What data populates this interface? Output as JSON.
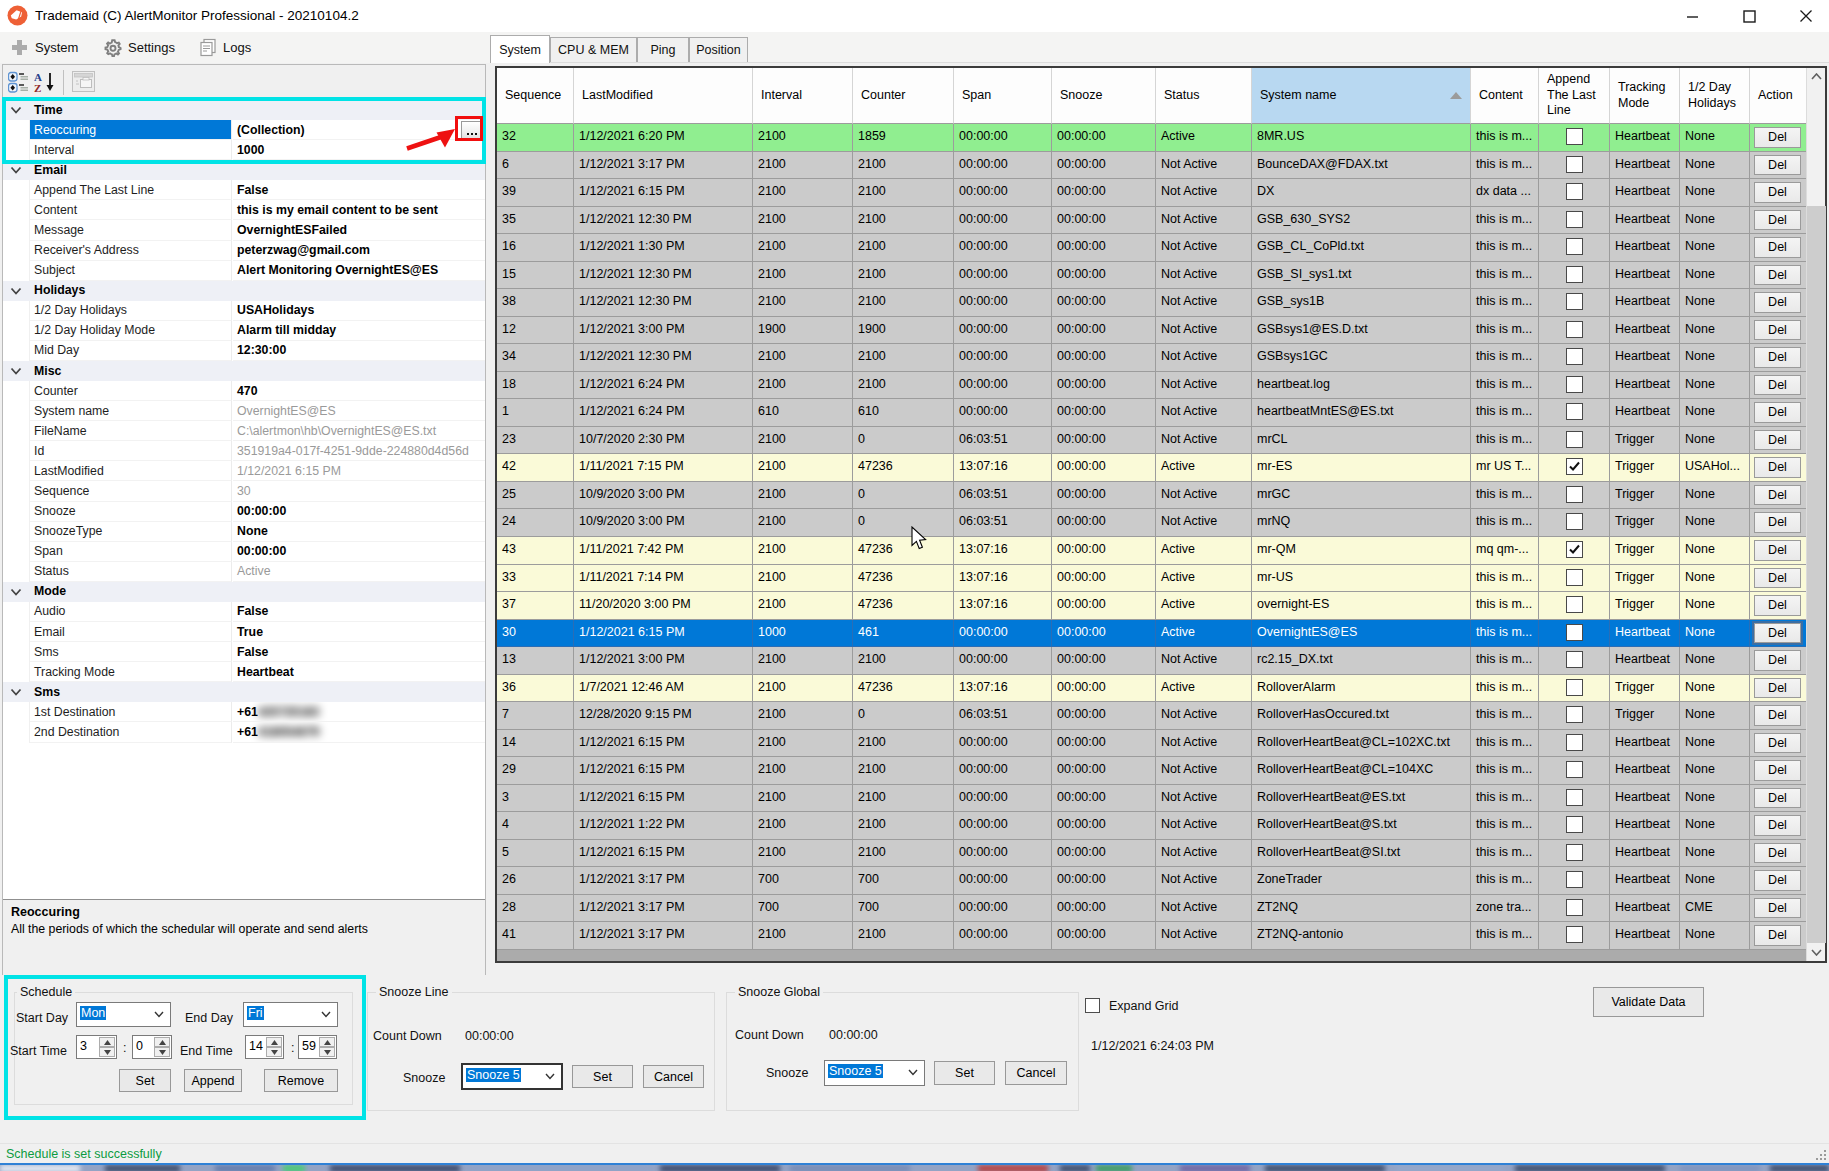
{
  "window": {
    "title": "Trademaid (C) AlertMonitor Professional - 20210104.2",
    "controls": [
      "minimize",
      "maximize",
      "close"
    ]
  },
  "menubar": {
    "items": [
      {
        "label": "System",
        "icon": "plus-icon"
      },
      {
        "label": "Settings",
        "icon": "gear-icon"
      },
      {
        "label": "Logs",
        "icon": "logs-icon"
      }
    ]
  },
  "property_grid": {
    "toolbar_icons": [
      "categorized-icon",
      "alphabetical-sort-icon",
      "property-pages-icon"
    ],
    "sections": [
      {
        "label": "Time",
        "items": [
          {
            "name": "Reoccuring",
            "value": "(Collection)",
            "selected": true,
            "button": "..."
          },
          {
            "name": "Interval",
            "value": "1000"
          }
        ]
      },
      {
        "label": "Email",
        "items": [
          {
            "name": "Append The Last Line",
            "value": "False"
          },
          {
            "name": "Content",
            "value": "this is my email content to be sent"
          },
          {
            "name": "Message",
            "value": "OvernightESFailed"
          },
          {
            "name": "Receiver's Address",
            "value": "peterzwag@gmail.com"
          },
          {
            "name": "Subject",
            "value": "Alert Monitoring OvernightES@ES"
          }
        ]
      },
      {
        "label": "Holidays",
        "items": [
          {
            "name": "1/2 Day Holidays",
            "value": "USAHolidays"
          },
          {
            "name": "1/2 Day Holiday Mode",
            "value": "Alarm till midday"
          },
          {
            "name": "Mid Day",
            "value": "12:30:00"
          }
        ]
      },
      {
        "label": "Misc",
        "items": [
          {
            "name": "Counter",
            "value": "470"
          },
          {
            "name": "System name",
            "value": "OvernightES@ES",
            "readonly": true
          },
          {
            "name": "FileName",
            "value": "C:\\alertmon\\hb\\OvernightES@ES.txt",
            "readonly": true
          },
          {
            "name": "Id",
            "value": "351919a4-017f-4251-9dde-224880d4d56d",
            "readonly": true
          },
          {
            "name": "LastModified",
            "value": "1/12/2021 6:15 PM",
            "readonly": true
          },
          {
            "name": "Sequence",
            "value": "30",
            "readonly": true
          },
          {
            "name": "Snooze",
            "value": "00:00:00"
          },
          {
            "name": "SnoozeType",
            "value": "None"
          },
          {
            "name": "Span",
            "value": "00:00:00"
          },
          {
            "name": "Status",
            "value": "Active",
            "readonly": true
          }
        ]
      },
      {
        "label": "Mode",
        "items": [
          {
            "name": "Audio",
            "value": "False"
          },
          {
            "name": "Email",
            "value": "True"
          },
          {
            "name": "Sms",
            "value": "False"
          },
          {
            "name": "Tracking Mode",
            "value": "Heartbeat"
          }
        ]
      },
      {
        "label": "Sms",
        "items": [
          {
            "name": "1st Destination",
            "value": "+61",
            "blurred_suffix": "425725183"
          },
          {
            "name": "2nd Destination",
            "value": "+61",
            "blurred_suffix": "418054679"
          }
        ]
      }
    ],
    "description": {
      "title": "Reoccuring",
      "text": "All the periods of which the schedular will operate and send alerts"
    }
  },
  "tabs": [
    "System",
    "CPU & MEM",
    "Ping",
    "Position"
  ],
  "selected_tab": "System",
  "grid": {
    "columns": [
      "Sequence",
      "LastModified",
      "Interval",
      "Counter",
      "Span",
      "Snooze",
      "Status",
      "System name",
      "Content",
      "Append The Last Line",
      "Tracking Mode",
      "1/2 Day Holidays",
      "Action"
    ],
    "sorted_column": "System name",
    "action_label": "Del",
    "rows": [
      {
        "seq": "32",
        "modified": "1/12/2021 6:20 PM",
        "interval": "2100",
        "counter": "1859",
        "span": "00:00:00",
        "snooze": "00:00:00",
        "status": "Active",
        "system": "8MR.US",
        "content": "this is m...",
        "checked": false,
        "tracking": "Heartbeat",
        "holidays": "None",
        "style": "green"
      },
      {
        "seq": "6",
        "modified": "1/12/2021 3:17 PM",
        "interval": "2100",
        "counter": "2100",
        "span": "00:00:00",
        "snooze": "00:00:00",
        "status": "Not Active",
        "system": "BounceDAX@FDAX.txt",
        "content": "this is m...",
        "checked": false,
        "tracking": "Heartbeat",
        "holidays": "None",
        "style": "gray"
      },
      {
        "seq": "39",
        "modified": "1/12/2021 6:15 PM",
        "interval": "2100",
        "counter": "2100",
        "span": "00:00:00",
        "snooze": "00:00:00",
        "status": "Not Active",
        "system": "DX",
        "content": "dx data ...",
        "checked": false,
        "tracking": "Heartbeat",
        "holidays": "None",
        "style": "gray"
      },
      {
        "seq": "35",
        "modified": "1/12/2021 12:30 PM",
        "interval": "2100",
        "counter": "2100",
        "span": "00:00:00",
        "snooze": "00:00:00",
        "status": "Not Active",
        "system": "GSB_630_SYS2",
        "content": "this is m...",
        "checked": false,
        "tracking": "Heartbeat",
        "holidays": "None",
        "style": "gray"
      },
      {
        "seq": "16",
        "modified": "1/12/2021 1:30 PM",
        "interval": "2100",
        "counter": "2100",
        "span": "00:00:00",
        "snooze": "00:00:00",
        "status": "Not Active",
        "system": "GSB_CL_CoPld.txt",
        "content": "this is m...",
        "checked": false,
        "tracking": "Heartbeat",
        "holidays": "None",
        "style": "gray"
      },
      {
        "seq": "15",
        "modified": "1/12/2021 12:30 PM",
        "interval": "2100",
        "counter": "2100",
        "span": "00:00:00",
        "snooze": "00:00:00",
        "status": "Not Active",
        "system": "GSB_SI_sys1.txt",
        "content": "this is m...",
        "checked": false,
        "tracking": "Heartbeat",
        "holidays": "None",
        "style": "gray"
      },
      {
        "seq": "38",
        "modified": "1/12/2021 12:30 PM",
        "interval": "2100",
        "counter": "2100",
        "span": "00:00:00",
        "snooze": "00:00:00",
        "status": "Not Active",
        "system": "GSB_sys1B",
        "content": "this is m...",
        "checked": false,
        "tracking": "Heartbeat",
        "holidays": "None",
        "style": "gray"
      },
      {
        "seq": "12",
        "modified": "1/12/2021 3:00 PM",
        "interval": "1900",
        "counter": "1900",
        "span": "00:00:00",
        "snooze": "00:00:00",
        "status": "Not Active",
        "system": "GSBsys1@ES.D.txt",
        "content": "this is m...",
        "checked": false,
        "tracking": "Heartbeat",
        "holidays": "None",
        "style": "gray"
      },
      {
        "seq": "34",
        "modified": "1/12/2021 12:30 PM",
        "interval": "2100",
        "counter": "2100",
        "span": "00:00:00",
        "snooze": "00:00:00",
        "status": "Not Active",
        "system": "GSBsys1GC",
        "content": "this is m...",
        "checked": false,
        "tracking": "Heartbeat",
        "holidays": "None",
        "style": "gray"
      },
      {
        "seq": "18",
        "modified": "1/12/2021 6:24 PM",
        "interval": "2100",
        "counter": "2100",
        "span": "00:00:00",
        "snooze": "00:00:00",
        "status": "Not Active",
        "system": "heartbeat.log",
        "content": "this is m...",
        "checked": false,
        "tracking": "Heartbeat",
        "holidays": "None",
        "style": "gray"
      },
      {
        "seq": "1",
        "modified": "1/12/2021 6:24 PM",
        "interval": "610",
        "counter": "610",
        "span": "00:00:00",
        "snooze": "00:00:00",
        "status": "Not Active",
        "system": "heartbeatMntES@ES.txt",
        "content": "this is m...",
        "checked": false,
        "tracking": "Heartbeat",
        "holidays": "None",
        "style": "gray"
      },
      {
        "seq": "23",
        "modified": "10/7/2020 2:30 PM",
        "interval": "2100",
        "counter": "0",
        "span": "06:03:51",
        "snooze": "00:00:00",
        "status": "Not Active",
        "system": "mrCL",
        "content": "this is m...",
        "checked": false,
        "tracking": "Trigger",
        "holidays": "None",
        "style": "gray"
      },
      {
        "seq": "42",
        "modified": "1/11/2021 7:15 PM",
        "interval": "2100",
        "counter": "47236",
        "span": "13:07:16",
        "snooze": "00:00:00",
        "status": "Active",
        "system": "mr-ES",
        "content": "mr US T...",
        "checked": true,
        "tracking": "Trigger",
        "holidays": "USAHol...",
        "style": "yellow"
      },
      {
        "seq": "25",
        "modified": "10/9/2020 3:00 PM",
        "interval": "2100",
        "counter": "0",
        "span": "06:03:51",
        "snooze": "00:00:00",
        "status": "Not Active",
        "system": "mrGC",
        "content": "this is m...",
        "checked": false,
        "tracking": "Trigger",
        "holidays": "None",
        "style": "gray"
      },
      {
        "seq": "24",
        "modified": "10/9/2020 3:00 PM",
        "interval": "2100",
        "counter": "0",
        "span": "06:03:51",
        "snooze": "00:00:00",
        "status": "Not Active",
        "system": "mrNQ",
        "content": "this is m...",
        "checked": false,
        "tracking": "Trigger",
        "holidays": "None",
        "style": "gray"
      },
      {
        "seq": "43",
        "modified": "1/11/2021 7:42 PM",
        "interval": "2100",
        "counter": "47236",
        "span": "13:07:16",
        "snooze": "00:00:00",
        "status": "Active",
        "system": "mr-QM",
        "content": "mq qm-...",
        "checked": true,
        "tracking": "Trigger",
        "holidays": "None",
        "style": "yellow"
      },
      {
        "seq": "33",
        "modified": "1/11/2021 7:14 PM",
        "interval": "2100",
        "counter": "47236",
        "span": "13:07:16",
        "snooze": "00:00:00",
        "status": "Active",
        "system": "mr-US",
        "content": "this is m...",
        "checked": false,
        "tracking": "Trigger",
        "holidays": "None",
        "style": "yellow"
      },
      {
        "seq": "37",
        "modified": "11/20/2020 3:00 PM",
        "interval": "2100",
        "counter": "47236",
        "span": "13:07:16",
        "snooze": "00:00:00",
        "status": "Active",
        "system": "overnight-ES",
        "content": "this is m...",
        "checked": false,
        "tracking": "Trigger",
        "holidays": "None",
        "style": "yellow"
      },
      {
        "seq": "30",
        "modified": "1/12/2021 6:15 PM",
        "interval": "1000",
        "counter": "461",
        "span": "00:00:00",
        "snooze": "00:00:00",
        "status": "Active",
        "system": "OvernightES@ES",
        "content": "this is m...",
        "checked": false,
        "tracking": "Heartbeat",
        "holidays": "None",
        "style": "selected"
      },
      {
        "seq": "13",
        "modified": "1/12/2021 3:00 PM",
        "interval": "2100",
        "counter": "2100",
        "span": "00:00:00",
        "snooze": "00:00:00",
        "status": "Not Active",
        "system": "rc2.15_DX.txt",
        "content": "this is m...",
        "checked": false,
        "tracking": "Heartbeat",
        "holidays": "None",
        "style": "gray"
      },
      {
        "seq": "36",
        "modified": "1/7/2021 12:46 AM",
        "interval": "2100",
        "counter": "47236",
        "span": "13:07:16",
        "snooze": "00:00:00",
        "status": "Active",
        "system": "RolloverAlarm",
        "content": "this is m...",
        "checked": false,
        "tracking": "Trigger",
        "holidays": "None",
        "style": "yellow"
      },
      {
        "seq": "7",
        "modified": "12/28/2020 9:15 PM",
        "interval": "2100",
        "counter": "0",
        "span": "06:03:51",
        "snooze": "00:00:00",
        "status": "Not Active",
        "system": "RolloverHasOccured.txt",
        "content": "this is m...",
        "checked": false,
        "tracking": "Trigger",
        "holidays": "None",
        "style": "gray"
      },
      {
        "seq": "14",
        "modified": "1/12/2021 6:15 PM",
        "interval": "2100",
        "counter": "2100",
        "span": "00:00:00",
        "snooze": "00:00:00",
        "status": "Not Active",
        "system": "RolloverHeartBeat@CL=102XC.txt",
        "content": "this is m...",
        "checked": false,
        "tracking": "Heartbeat",
        "holidays": "None",
        "style": "gray"
      },
      {
        "seq": "29",
        "modified": "1/12/2021 6:15 PM",
        "interval": "2100",
        "counter": "2100",
        "span": "00:00:00",
        "snooze": "00:00:00",
        "status": "Not Active",
        "system": "RolloverHeartBeat@CL=104XC",
        "content": "this is m...",
        "checked": false,
        "tracking": "Heartbeat",
        "holidays": "None",
        "style": "gray"
      },
      {
        "seq": "3",
        "modified": "1/12/2021 6:15 PM",
        "interval": "2100",
        "counter": "2100",
        "span": "00:00:00",
        "snooze": "00:00:00",
        "status": "Not Active",
        "system": "RolloverHeartBeat@ES.txt",
        "content": "this is m...",
        "checked": false,
        "tracking": "Heartbeat",
        "holidays": "None",
        "style": "gray"
      },
      {
        "seq": "4",
        "modified": "1/12/2021 1:22 PM",
        "interval": "2100",
        "counter": "2100",
        "span": "00:00:00",
        "snooze": "00:00:00",
        "status": "Not Active",
        "system": "RolloverHeartBeat@S.txt",
        "content": "this is m...",
        "checked": false,
        "tracking": "Heartbeat",
        "holidays": "None",
        "style": "gray"
      },
      {
        "seq": "5",
        "modified": "1/12/2021 6:15 PM",
        "interval": "2100",
        "counter": "2100",
        "span": "00:00:00",
        "snooze": "00:00:00",
        "status": "Not Active",
        "system": "RolloverHeartBeat@SI.txt",
        "content": "this is m...",
        "checked": false,
        "tracking": "Heartbeat",
        "holidays": "None",
        "style": "gray"
      },
      {
        "seq": "26",
        "modified": "1/12/2021 3:17 PM",
        "interval": "700",
        "counter": "700",
        "span": "00:00:00",
        "snooze": "00:00:00",
        "status": "Not Active",
        "system": "ZoneTrader",
        "content": "this is m...",
        "checked": false,
        "tracking": "Heartbeat",
        "holidays": "None",
        "style": "gray"
      },
      {
        "seq": "28",
        "modified": "1/12/2021 3:17 PM",
        "interval": "700",
        "counter": "700",
        "span": "00:00:00",
        "snooze": "00:00:00",
        "status": "Not Active",
        "system": "ZT2NQ",
        "content": "zone tra...",
        "checked": false,
        "tracking": "Heartbeat",
        "holidays": "CME",
        "style": "gray"
      },
      {
        "seq": "41",
        "modified": "1/12/2021 3:17 PM",
        "interval": "2100",
        "counter": "2100",
        "span": "00:00:00",
        "snooze": "00:00:00",
        "status": "Not Active",
        "system": "ZT2NQ-antonio",
        "content": "this is m...",
        "checked": false,
        "tracking": "Heartbeat",
        "holidays": "None",
        "style": "gray"
      }
    ]
  },
  "schedule": {
    "label": "Schedule",
    "start_day_label": "Start Day",
    "start_day": "Mon",
    "end_day_label": "End Day",
    "end_day": "Fri",
    "start_time_label": "Start Time",
    "start_hour": "3",
    "start_min": "0",
    "end_time_label": "End Time",
    "end_hour": "14",
    "end_min": "59",
    "buttons": {
      "set": "Set",
      "append": "Append",
      "remove": "Remove"
    }
  },
  "snooze_line": {
    "label": "Snooze Line",
    "count_down_label": "Count Down",
    "count_down": "00:00:00",
    "snooze_label": "Snooze",
    "snooze_value": "Snooze 5",
    "set_label": "Set",
    "cancel_label": "Cancel"
  },
  "snooze_global": {
    "label": "Snooze Global",
    "count_down_label": "Count Down",
    "count_down": "00:00:00",
    "snooze_label": "Snooze",
    "snooze_value": "Snooze 5",
    "set_label": "Set",
    "cancel_label": "Cancel"
  },
  "misc_bottom": {
    "expand_grid_label": "Expand Grid",
    "expand_grid_checked": false,
    "timestamp": "1/12/2021 6:24:03 PM",
    "validate_button": "Validate Data"
  },
  "statusbar": {
    "text": "Schedule is set successfully",
    "color": "#0c9b40"
  },
  "colors": {
    "accent_blue": "#0078d7",
    "highlight_cyan": "#00e3e6",
    "annotation_red": "#f10e0e",
    "row_green": "#90ee90",
    "row_gray": "#cbcbcb",
    "row_yellow": "#fafad8",
    "sorted_header_blue": "#b8d8f1",
    "app_icon_orange": "#ee6036"
  },
  "taskbar_strip_colors": {
    "accent_line": "#2f81d6",
    "blobs": [
      [
        "#f4f7fc",
        0,
        80
      ],
      [
        "#31405e",
        105,
        75
      ],
      [
        "#5c76a8",
        215,
        60
      ],
      [
        "#3bd467",
        283,
        22
      ],
      [
        "#2e3d5e",
        330,
        130
      ],
      [
        "#8fa3c8",
        470,
        180
      ],
      [
        "#2e3d5e",
        660,
        120
      ],
      [
        "#7288b4",
        790,
        120
      ],
      [
        "#c03028",
        978,
        70
      ],
      [
        "#30405f",
        1060,
        30
      ],
      [
        "#2e9e52",
        1096,
        36
      ],
      [
        "#6a5a9e",
        1180,
        70
      ],
      [
        "#30405f",
        1265,
        120
      ],
      [
        "#94a8cc",
        1395,
        110
      ],
      [
        "#30405f",
        1515,
        150
      ],
      [
        "#7d93be",
        1680,
        80
      ],
      [
        "#30405f",
        1770,
        59
      ]
    ]
  }
}
